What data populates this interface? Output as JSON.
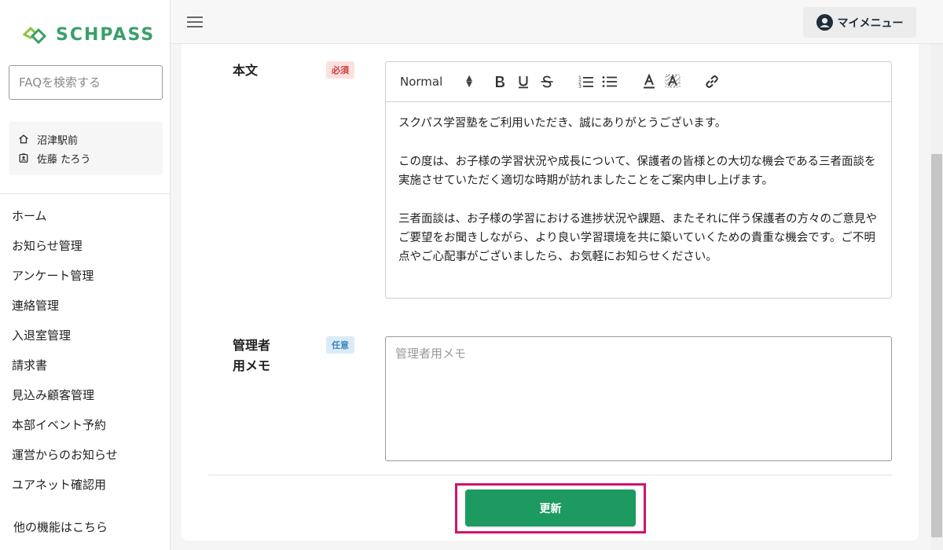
{
  "app": {
    "logo_text": "SCHPASS"
  },
  "sidebar": {
    "search_placeholder": "FAQを検索する",
    "school": "沼津駅前",
    "user": "佐藤 たろう",
    "nav_items": [
      {
        "label": "ホーム",
        "icon": "none"
      },
      {
        "label": "お知らせ管理",
        "icon": "none"
      },
      {
        "label": "アンケート管理",
        "icon": "none"
      },
      {
        "label": "連絡管理",
        "icon": "none"
      },
      {
        "label": "入退室管理",
        "icon": "none"
      },
      {
        "label": "請求書",
        "icon": "none"
      },
      {
        "label": "見込み顧客管理",
        "icon": "none"
      },
      {
        "label": "本部イベント予約",
        "icon": "none"
      },
      {
        "label": "運営からのお知らせ",
        "icon": "none"
      },
      {
        "label": "ユアネット確認用",
        "icon": "none"
      }
    ],
    "more_link": "他の機能はこちら"
  },
  "header": {
    "my_menu_label": "マイメニュー"
  },
  "form": {
    "body_label": "本文",
    "body_badge": "必須",
    "editor": {
      "format_value": "Normal",
      "paragraphs": [
        "スクパス学習塾をご利用いただき、誠にありがとうございます。",
        "この度は、お子様の学習状況や成長について、保護者の皆様との大切な機会である三者面談を実施させていただく適切な時期が訪れましたことをご案内申し上げます。",
        "三者面談は、お子様の学習における進捗状況や課題、またそれに伴う保護者の方々のご意見やご要望をお聞きしながら、より良い学習環境を共に築いていくための貴重な機会です。ご不明点やご心配事がございましたら、お気軽にお知らせください。"
      ]
    },
    "memo_label_line1": "管理者",
    "memo_label_line2": "用メモ",
    "memo_badge": "任意",
    "memo_placeholder": "管理者用メモ",
    "submit_label": "更新"
  },
  "colors": {
    "brand_green": "#3aa06a",
    "button_green": "#1d9a60",
    "highlight_border": "#d0146c",
    "required_badge": "#d23b3b",
    "optional_badge": "#3b86c4"
  }
}
